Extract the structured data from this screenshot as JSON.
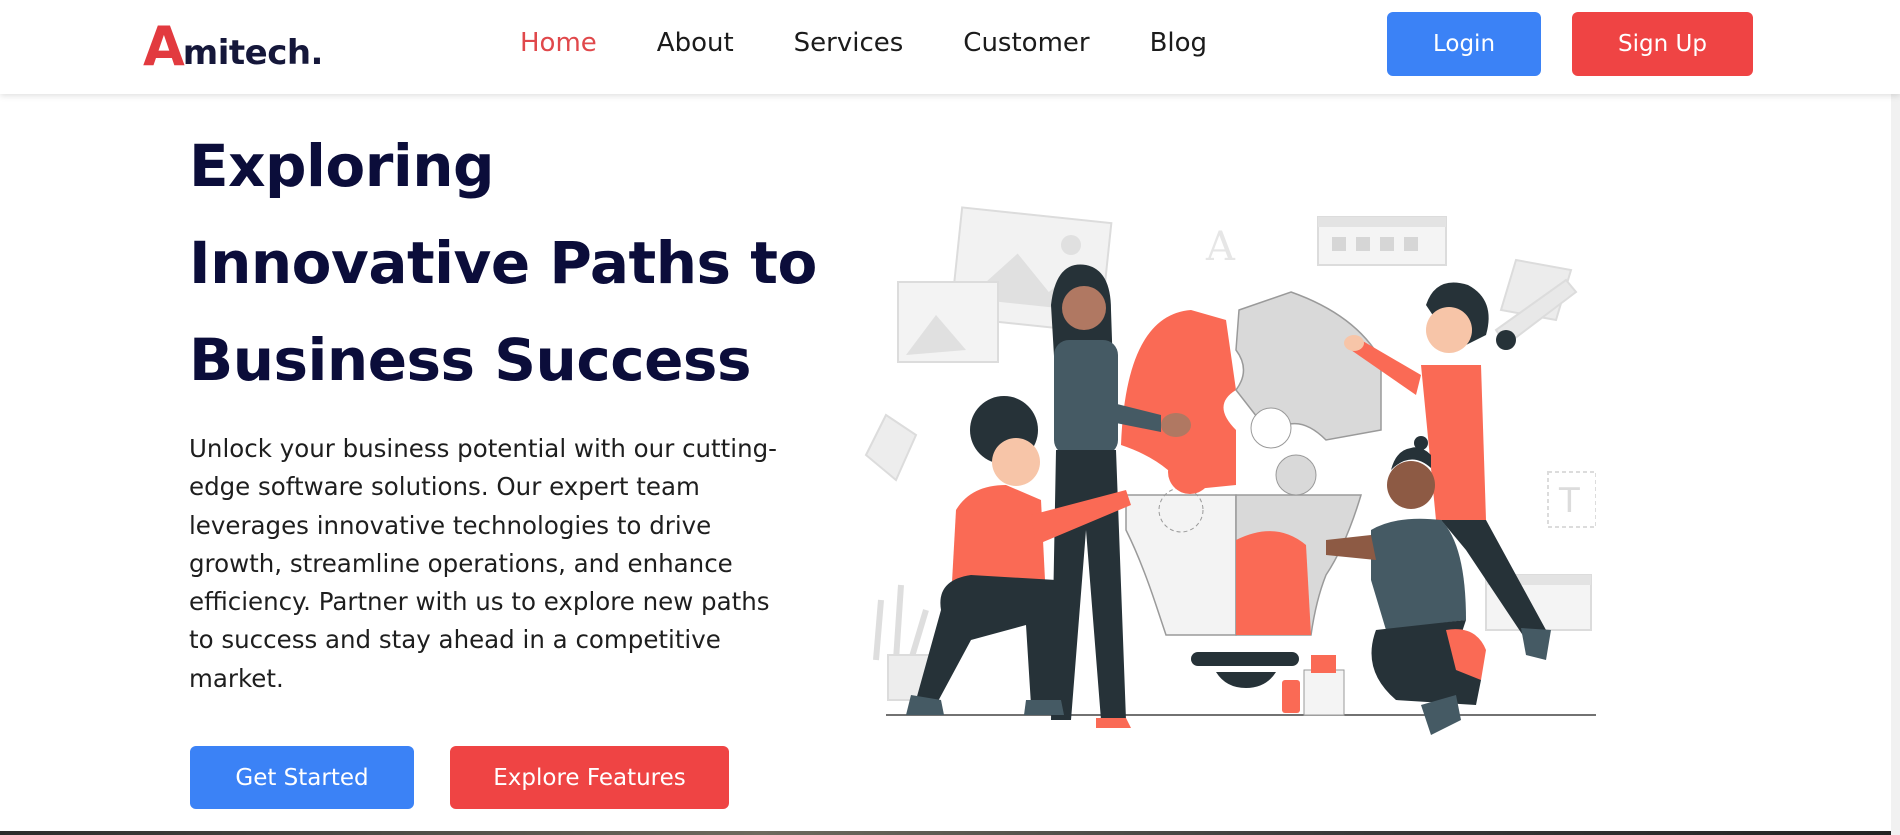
{
  "brand": {
    "logo_initial": "A",
    "logo_rest": "mitech.",
    "accent_color": "#e23a3f"
  },
  "nav": {
    "items": [
      {
        "label": "Home",
        "active": true
      },
      {
        "label": "About",
        "active": false
      },
      {
        "label": "Services",
        "active": false
      },
      {
        "label": "Customer",
        "active": false
      },
      {
        "label": "Blog",
        "active": false
      }
    ]
  },
  "auth": {
    "login_label": "Login",
    "signup_label": "Sign Up"
  },
  "hero": {
    "title_lines": [
      "Exploring",
      "Innovative Paths to",
      "Business Success"
    ],
    "description": "Unlock your business potential with our cutting-edge software solutions. Our expert team leverages innovative technologies to drive growth, streamline operations, and enhance efficiency. Partner with us to explore new paths to success and stay ahead in a competitive market.",
    "primary_cta": "Get Started",
    "secondary_cta": "Explore Features",
    "illustration_letters": [
      "A",
      "T"
    ]
  },
  "colors": {
    "primary_blue": "#3b82f6",
    "primary_red": "#ef4444",
    "heading": "#0b0d3a"
  }
}
